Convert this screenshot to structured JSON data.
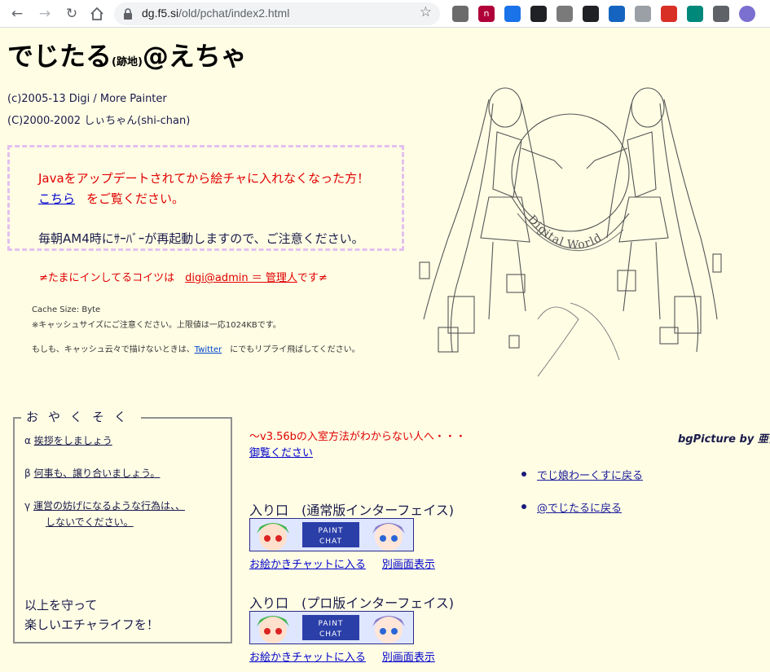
{
  "browser": {
    "url_host": "dg.f5.si",
    "url_path": "/old/pchat/index2.html",
    "icons": {
      "back": "arrow-left-icon",
      "forward": "arrow-right-icon",
      "reload": "reload-icon",
      "home": "home-icon",
      "lock": "lock-icon",
      "bookmark": "star-icon"
    },
    "extensions": [
      {
        "name": "circle-ext-icon",
        "color": "#6b6b6b",
        "glyph": ""
      },
      {
        "name": "n-ext-icon",
        "color": "#b0003a",
        "glyph": "n"
      },
      {
        "name": "window-ext-icon",
        "color": "#1a73e8",
        "glyph": ""
      },
      {
        "name": "fox-ext-icon",
        "color": "#202124",
        "glyph": ""
      },
      {
        "name": "shield-ext-icon",
        "color": "#7a7a7a",
        "glyph": ""
      },
      {
        "name": "sync-ext-icon",
        "color": "#202124",
        "glyph": ""
      },
      {
        "name": "flame-ext-icon",
        "color": "#1565c0",
        "glyph": ""
      },
      {
        "name": "cast-ext-icon",
        "color": "#9aa0a6",
        "glyph": ""
      },
      {
        "name": "record-ext-icon",
        "color": "#d93025",
        "glyph": ""
      },
      {
        "name": "swirl-ext-icon",
        "color": "#00897b",
        "glyph": ""
      },
      {
        "name": "puzzle-icon",
        "color": "#5f6368",
        "glyph": ""
      },
      {
        "name": "profile-avatar-icon",
        "color": "#7b6fd0",
        "glyph": ""
      }
    ]
  },
  "page": {
    "title_main": "でじたる",
    "title_small": "(跡地)",
    "title_suffix": "@えちゃ",
    "copyright": [
      "(c)2005-13 Digi / More Painter",
      "(C)2000-2002 しぃちゃん(shi-chan)"
    ],
    "notice": {
      "line1": "Javaをアップデートされてから絵チャに入れなくなった方！",
      "link": "こちら",
      "line2_suffix": "をご覧ください。",
      "line3": "毎朝AM4時にｻｰﾊﾞｰが再起動しますので、ご注意ください。"
    },
    "admin": {
      "prefix": "≠たまにインしてるコイツは",
      "link": "digi@admin ＝ 管理人",
      "suffix": "です≠"
    },
    "cache": {
      "size_label": "Cache Size: Byte",
      "warning": "※キャッシュサイズにご注意ください。上限値は一応1024KBです。",
      "twitter_prefix": "もしも、キャッシュ云々で描けないときは、",
      "twitter_link": "Twitter",
      "twitter_suffix": "にでもリプライ飛ばしてください。"
    },
    "art_text": "Digital World",
    "rules": {
      "legend": "おやくそく",
      "items": [
        {
          "marker": "α",
          "text": "挨拶をしましょう"
        },
        {
          "marker": "β",
          "text": "何事も、譲り合いましょう。"
        },
        {
          "marker": "γ",
          "text": "運営の妨げになるような行為は、、",
          "text2": "しないでください。"
        }
      ],
      "footer1": "以上を守って",
      "footer2": "楽しいエチャライフを！"
    },
    "how_to": {
      "text": "～v3.56bの入室方法がわからない人へ・・・",
      "link": "御覧ください"
    },
    "credit": "bgPicture by 亜依",
    "side_links": [
      "でじ娘わーくすに戻る",
      "@でじたるに戻る"
    ],
    "entries": [
      {
        "heading": "入り口　(通常版インターフェイス)",
        "banner_text1": "PAINT",
        "banner_text2": "CHAT",
        "enter": "お絵かきチャットに入る",
        "popup": "別画面表示"
      },
      {
        "heading": "入り口　(プロ版インターフェイス)",
        "banner_text1": "PAINT",
        "banner_text2": "CHAT",
        "enter": "お絵かきチャットに入る",
        "popup": "別画面表示"
      }
    ]
  }
}
